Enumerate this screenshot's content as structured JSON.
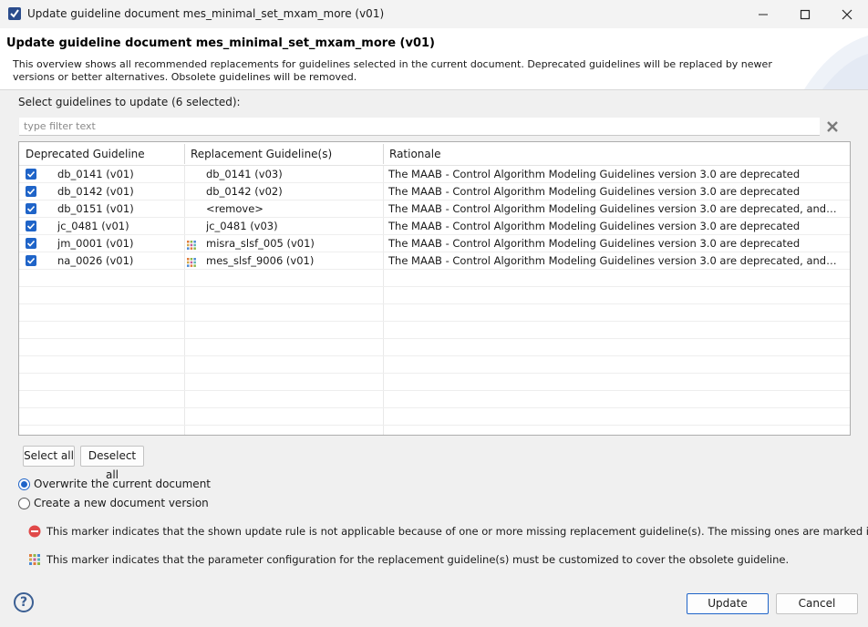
{
  "window": {
    "title": "Update guideline document mes_minimal_set_mxam_more (v01)"
  },
  "header": {
    "title": "Update guideline document mes_minimal_set_mxam_more (v01)",
    "description": "This overview shows all recommended replacements for guidelines selected in the current document. Deprecated guidelines will be replaced by newer versions or better alternatives. Obsolete guidelines will be removed."
  },
  "selection": {
    "label": "Select guidelines to update (6 selected):",
    "filter_placeholder": "type filter text"
  },
  "table": {
    "columns": [
      "Deprecated Guideline",
      "Replacement Guideline(s)",
      "Rationale"
    ],
    "rows": [
      {
        "checked": true,
        "deprecated": "db_0141 (v01)",
        "replacement": "db_0141 (v03)",
        "param_marker": false,
        "rationale": "The MAAB - Control Algorithm Modeling Guidelines version 3.0 are deprecated"
      },
      {
        "checked": true,
        "deprecated": "db_0142 (v01)",
        "replacement": "db_0142 (v02)",
        "param_marker": false,
        "rationale": "The MAAB - Control Algorithm Modeling Guidelines version 3.0 are deprecated"
      },
      {
        "checked": true,
        "deprecated": "db_0151 (v01)",
        "replacement": "<remove>",
        "param_marker": false,
        "rationale": "The MAAB - Control Algorithm Modeling Guidelines version 3.0 are deprecated, and it was r..."
      },
      {
        "checked": true,
        "deprecated": "jc_0481 (v01)",
        "replacement": "jc_0481 (v03)",
        "param_marker": false,
        "rationale": "The MAAB - Control Algorithm Modeling Guidelines version 3.0 are deprecated"
      },
      {
        "checked": true,
        "deprecated": "jm_0001 (v01)",
        "replacement": "misra_slsf_005 (v01)",
        "param_marker": true,
        "rationale": "The MAAB - Control Algorithm Modeling Guidelines version 3.0 are deprecated"
      },
      {
        "checked": true,
        "deprecated": "na_0026 (v01)",
        "replacement": "mes_slsf_9006 (v01)",
        "param_marker": true,
        "rationale": "The MAAB - Control Algorithm Modeling Guidelines version 3.0 are deprecated, and it was r..."
      }
    ]
  },
  "buttons": {
    "select_all": "Select all",
    "deselect_all": "Deselect all",
    "update": "Update",
    "cancel": "Cancel",
    "help": "?"
  },
  "options": {
    "overwrite": "Overwrite the current document",
    "new_version": "Create a new document version",
    "selected": "overwrite"
  },
  "legend": {
    "missing_marker": "This marker indicates that the shown update rule is not applicable because of one or more missing replacement guideline(s). The missing ones are marked in red.",
    "param_marker": "This marker indicates that the parameter configuration for the replacement guideline(s) must be customized to cover the obsolete guideline."
  },
  "colors": {
    "accent": "#1f64c8",
    "error": "#e04848",
    "help": "#3b5f93"
  },
  "icons": {
    "app": "app-check-icon",
    "clear_filter": "clear-icon",
    "missing": "error-icon",
    "param": "param-grid-icon",
    "help": "help-icon"
  }
}
